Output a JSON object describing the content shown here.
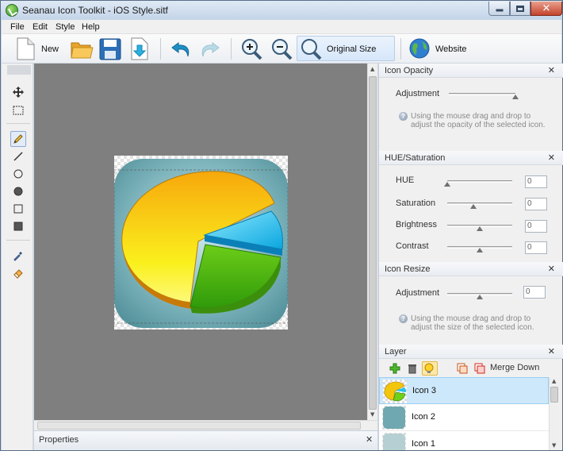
{
  "window": {
    "title": "Seanau Icon Toolkit - iOS Style.sitf"
  },
  "menu": [
    "File",
    "Edit",
    "Style",
    "Help"
  ],
  "toolbar": {
    "new_label": "New",
    "original_size_label": "Original Size",
    "website_label": "Website"
  },
  "tools": [
    "move-icon",
    "marquee-select-icon",
    "pencil-icon",
    "line-icon",
    "ellipse-icon",
    "filled-ellipse-icon",
    "rectangle-icon",
    "filled-rectangle-icon",
    "eyedropper-icon",
    "eraser-icon"
  ],
  "properties": {
    "title": "Properties"
  },
  "panels": {
    "opacity": {
      "title": "Icon Opacity",
      "adjustment_label": "Adjustment",
      "hint": "Using the mouse drag and drop to adjust the opacity of the selected icon.",
      "level": 1.0
    },
    "hue_saturation": {
      "title": "HUE/Saturation",
      "rows": [
        {
          "label": "HUE",
          "value": "0",
          "level": 0.0
        },
        {
          "label": "Saturation",
          "value": "0",
          "level": 0.4
        },
        {
          "label": "Brightness",
          "value": "0",
          "level": 0.5
        },
        {
          "label": "Contrast",
          "value": "0",
          "level": 0.5
        }
      ]
    },
    "resize": {
      "title": "Icon Resize",
      "adjustment_label": "Adjustment",
      "value": "0",
      "hint": "Using the mouse drag and drop to adjust the size of the selected icon.",
      "level": 0.5
    },
    "layer": {
      "title": "Layer",
      "merge_label": "Merge Down",
      "layers": [
        {
          "name": "Icon 3",
          "selected": true
        },
        {
          "name": "Icon 2",
          "selected": false
        },
        {
          "name": "Icon 1",
          "selected": false
        }
      ]
    }
  },
  "colors": {
    "canvas_bg": "#7f7f7f",
    "selection": "#cde8fb",
    "icon_bg": "#6fa8b0",
    "pie_yellow": "#f2c20a",
    "pie_green": "#7ad51e",
    "pie_cyan": "#23c6ef"
  }
}
